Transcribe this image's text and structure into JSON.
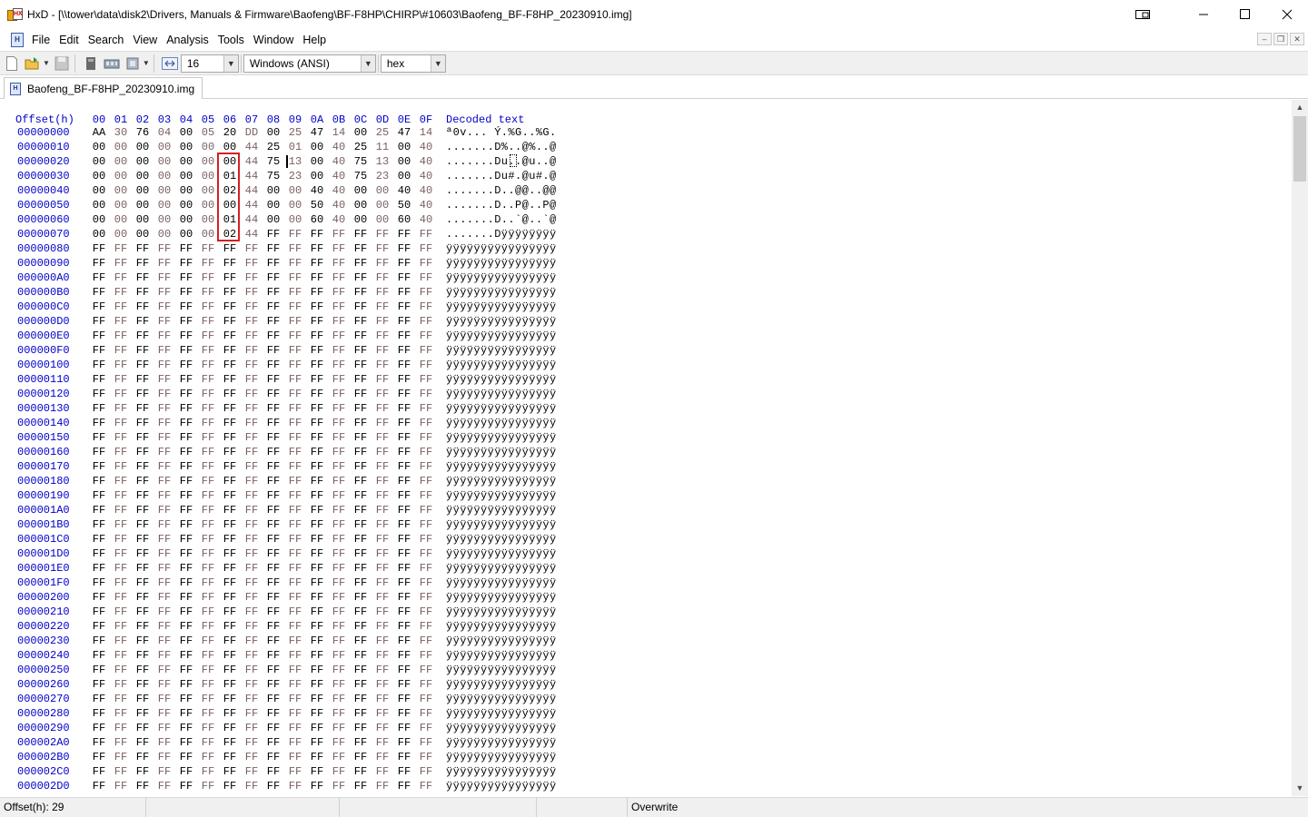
{
  "window": {
    "title": "HxD - [\\\\tower\\data\\disk2\\Drivers, Manuals & Firmware\\Baofeng\\BF-F8HP\\CHIRP\\#10603\\Baofeng_BF-F8HP_20230910.img]",
    "app_icon": "hxd-icon",
    "controls": [
      "compact-overlay-icon",
      "minimize-icon",
      "maximize-icon",
      "close-icon"
    ]
  },
  "menu": {
    "items": [
      "File",
      "Edit",
      "Search",
      "View",
      "Analysis",
      "Tools",
      "Window",
      "Help"
    ]
  },
  "toolbar": {
    "bytes_per_row": "16",
    "charset": "Windows (ANSI)",
    "offset_base": "hex",
    "icons": [
      "new-file-icon",
      "open-file-icon",
      "save-icon",
      "open-disk-icon",
      "open-ram-icon",
      "open-flash-icon",
      "bytes-per-row-icon"
    ]
  },
  "tab": {
    "label": "Baofeng_BF-F8HP_20230910.img"
  },
  "editor": {
    "offset_header": "Offset(h)",
    "columns": [
      "00",
      "01",
      "02",
      "03",
      "04",
      "05",
      "06",
      "07",
      "08",
      "09",
      "0A",
      "0B",
      "0C",
      "0D",
      "0E",
      "0F"
    ],
    "text_header": "Decoded text",
    "rows": [
      {
        "offset": "00000000",
        "bytes": [
          "AA",
          "30",
          "76",
          "04",
          "00",
          "05",
          "20",
          "DD",
          "00",
          "25",
          "47",
          "14",
          "00",
          "25",
          "47",
          "14"
        ],
        "text": "ª0v... Ý.%G..%G."
      },
      {
        "offset": "00000010",
        "bytes": [
          "00",
          "00",
          "00",
          "00",
          "00",
          "00",
          "00",
          "44",
          "25",
          "01",
          "00",
          "40",
          "25",
          "11",
          "00",
          "40"
        ],
        "text": ".......D%..@%..@"
      },
      {
        "offset": "00000020",
        "bytes": [
          "00",
          "00",
          "00",
          "00",
          "00",
          "00",
          "00",
          "44",
          "75",
          "13",
          "00",
          "40",
          "75",
          "13",
          "00",
          "40"
        ],
        "text": ".......Du..@u..@"
      },
      {
        "offset": "00000030",
        "bytes": [
          "00",
          "00",
          "00",
          "00",
          "00",
          "00",
          "01",
          "44",
          "75",
          "23",
          "00",
          "40",
          "75",
          "23",
          "00",
          "40"
        ],
        "text": ".......Du#.@u#.@"
      },
      {
        "offset": "00000040",
        "bytes": [
          "00",
          "00",
          "00",
          "00",
          "00",
          "00",
          "02",
          "44",
          "00",
          "00",
          "40",
          "40",
          "00",
          "00",
          "40",
          "40"
        ],
        "text": ".......D..@@..@@"
      },
      {
        "offset": "00000050",
        "bytes": [
          "00",
          "00",
          "00",
          "00",
          "00",
          "00",
          "00",
          "44",
          "00",
          "00",
          "50",
          "40",
          "00",
          "00",
          "50",
          "40"
        ],
        "text": ".......D..P@..P@"
      },
      {
        "offset": "00000060",
        "bytes": [
          "00",
          "00",
          "00",
          "00",
          "00",
          "00",
          "01",
          "44",
          "00",
          "00",
          "60",
          "40",
          "00",
          "00",
          "60",
          "40"
        ],
        "text": ".......D..`@..`@"
      },
      {
        "offset": "00000070",
        "bytes": [
          "00",
          "00",
          "00",
          "00",
          "00",
          "00",
          "02",
          "44",
          "FF",
          "FF",
          "FF",
          "FF",
          "FF",
          "FF",
          "FF",
          "FF"
        ],
        "text": ".......Dÿÿÿÿÿÿÿÿ"
      },
      {
        "offset": "00000080",
        "fill": "FF",
        "text": "ÿÿÿÿÿÿÿÿÿÿÿÿÿÿÿÿ"
      },
      {
        "offset": "00000090",
        "fill": "FF",
        "text": "ÿÿÿÿÿÿÿÿÿÿÿÿÿÿÿÿ"
      },
      {
        "offset": "000000A0",
        "fill": "FF",
        "text": "ÿÿÿÿÿÿÿÿÿÿÿÿÿÿÿÿ"
      },
      {
        "offset": "000000B0",
        "fill": "FF",
        "text": "ÿÿÿÿÿÿÿÿÿÿÿÿÿÿÿÿ"
      },
      {
        "offset": "000000C0",
        "fill": "FF",
        "text": "ÿÿÿÿÿÿÿÿÿÿÿÿÿÿÿÿ"
      },
      {
        "offset": "000000D0",
        "fill": "FF",
        "text": "ÿÿÿÿÿÿÿÿÿÿÿÿÿÿÿÿ"
      },
      {
        "offset": "000000E0",
        "fill": "FF",
        "text": "ÿÿÿÿÿÿÿÿÿÿÿÿÿÿÿÿ"
      },
      {
        "offset": "000000F0",
        "fill": "FF",
        "text": "ÿÿÿÿÿÿÿÿÿÿÿÿÿÿÿÿ"
      },
      {
        "offset": "00000100",
        "fill": "FF",
        "text": "ÿÿÿÿÿÿÿÿÿÿÿÿÿÿÿÿ"
      },
      {
        "offset": "00000110",
        "fill": "FF",
        "text": "ÿÿÿÿÿÿÿÿÿÿÿÿÿÿÿÿ"
      },
      {
        "offset": "00000120",
        "fill": "FF",
        "text": "ÿÿÿÿÿÿÿÿÿÿÿÿÿÿÿÿ"
      },
      {
        "offset": "00000130",
        "fill": "FF",
        "text": "ÿÿÿÿÿÿÿÿÿÿÿÿÿÿÿÿ"
      },
      {
        "offset": "00000140",
        "fill": "FF",
        "text": "ÿÿÿÿÿÿÿÿÿÿÿÿÿÿÿÿ"
      },
      {
        "offset": "00000150",
        "fill": "FF",
        "text": "ÿÿÿÿÿÿÿÿÿÿÿÿÿÿÿÿ"
      },
      {
        "offset": "00000160",
        "fill": "FF",
        "text": "ÿÿÿÿÿÿÿÿÿÿÿÿÿÿÿÿ"
      },
      {
        "offset": "00000170",
        "fill": "FF",
        "text": "ÿÿÿÿÿÿÿÿÿÿÿÿÿÿÿÿ"
      },
      {
        "offset": "00000180",
        "fill": "FF",
        "text": "ÿÿÿÿÿÿÿÿÿÿÿÿÿÿÿÿ"
      },
      {
        "offset": "00000190",
        "fill": "FF",
        "text": "ÿÿÿÿÿÿÿÿÿÿÿÿÿÿÿÿ"
      },
      {
        "offset": "000001A0",
        "fill": "FF",
        "text": "ÿÿÿÿÿÿÿÿÿÿÿÿÿÿÿÿ"
      },
      {
        "offset": "000001B0",
        "fill": "FF",
        "text": "ÿÿÿÿÿÿÿÿÿÿÿÿÿÿÿÿ"
      },
      {
        "offset": "000001C0",
        "fill": "FF",
        "text": "ÿÿÿÿÿÿÿÿÿÿÿÿÿÿÿÿ"
      },
      {
        "offset": "000001D0",
        "fill": "FF",
        "text": "ÿÿÿÿÿÿÿÿÿÿÿÿÿÿÿÿ"
      },
      {
        "offset": "000001E0",
        "fill": "FF",
        "text": "ÿÿÿÿÿÿÿÿÿÿÿÿÿÿÿÿ"
      },
      {
        "offset": "000001F0",
        "fill": "FF",
        "text": "ÿÿÿÿÿÿÿÿÿÿÿÿÿÿÿÿ"
      },
      {
        "offset": "00000200",
        "fill": "FF",
        "text": "ÿÿÿÿÿÿÿÿÿÿÿÿÿÿÿÿ"
      },
      {
        "offset": "00000210",
        "fill": "FF",
        "text": "ÿÿÿÿÿÿÿÿÿÿÿÿÿÿÿÿ"
      },
      {
        "offset": "00000220",
        "fill": "FF",
        "text": "ÿÿÿÿÿÿÿÿÿÿÿÿÿÿÿÿ"
      },
      {
        "offset": "00000230",
        "fill": "FF",
        "text": "ÿÿÿÿÿÿÿÿÿÿÿÿÿÿÿÿ"
      },
      {
        "offset": "00000240",
        "fill": "FF",
        "text": "ÿÿÿÿÿÿÿÿÿÿÿÿÿÿÿÿ"
      },
      {
        "offset": "00000250",
        "fill": "FF",
        "text": "ÿÿÿÿÿÿÿÿÿÿÿÿÿÿÿÿ"
      },
      {
        "offset": "00000260",
        "fill": "FF",
        "text": "ÿÿÿÿÿÿÿÿÿÿÿÿÿÿÿÿ"
      },
      {
        "offset": "00000270",
        "fill": "FF",
        "text": "ÿÿÿÿÿÿÿÿÿÿÿÿÿÿÿÿ"
      },
      {
        "offset": "00000280",
        "fill": "FF",
        "text": "ÿÿÿÿÿÿÿÿÿÿÿÿÿÿÿÿ"
      },
      {
        "offset": "00000290",
        "fill": "FF",
        "text": "ÿÿÿÿÿÿÿÿÿÿÿÿÿÿÿÿ"
      },
      {
        "offset": "000002A0",
        "fill": "FF",
        "text": "ÿÿÿÿÿÿÿÿÿÿÿÿÿÿÿÿ"
      },
      {
        "offset": "000002B0",
        "fill": "FF",
        "text": "ÿÿÿÿÿÿÿÿÿÿÿÿÿÿÿÿ"
      },
      {
        "offset": "000002C0",
        "fill": "FF",
        "text": "ÿÿÿÿÿÿÿÿÿÿÿÿÿÿÿÿ"
      },
      {
        "offset": "000002D0",
        "fill": "FF",
        "text": "ÿÿÿÿÿÿÿÿÿÿÿÿÿÿÿÿ"
      }
    ]
  },
  "status": {
    "offset": "Offset(h): 29",
    "mode": "Overwrite"
  },
  "colors": {
    "offset_blue": "#0000c8",
    "odd_column": "#7b6060",
    "selection_border": "#d42020"
  }
}
